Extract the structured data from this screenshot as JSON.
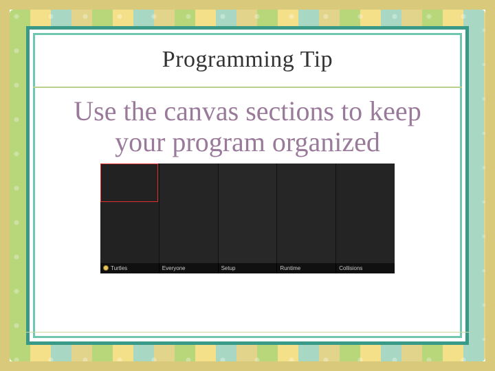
{
  "slide": {
    "title": "Programming Tip",
    "body": "Use the canvas sections to keep your program organized"
  },
  "canvas": {
    "sections": [
      {
        "label": "Turtles",
        "has_icon": true
      },
      {
        "label": "Everyone",
        "has_icon": false
      },
      {
        "label": "Setup",
        "has_icon": false
      },
      {
        "label": "Runtime",
        "has_icon": false
      },
      {
        "label": "Collisions",
        "has_icon": false
      }
    ]
  },
  "colors": {
    "frame_outer": "#3a9a88",
    "frame_inner": "#6fc7b0",
    "title_rule": "#b8d08a",
    "body_text": "#9a7a9a",
    "highlight_box": "#e03030"
  }
}
